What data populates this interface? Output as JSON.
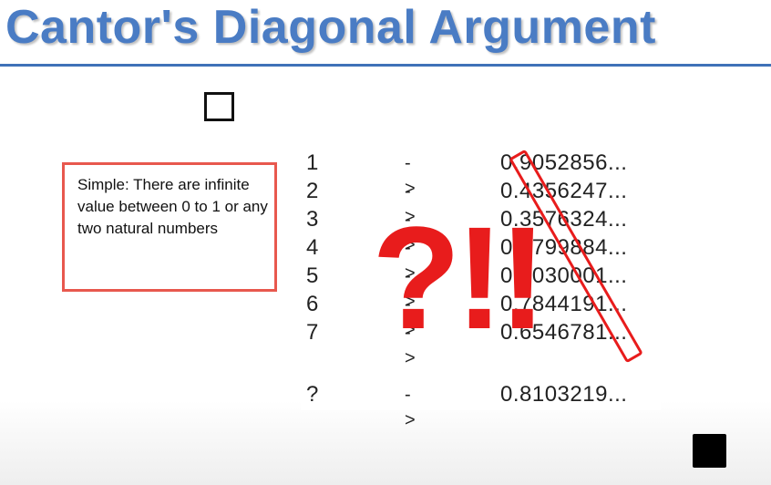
{
  "slide": {
    "title": "Cantor's Diagonal Argument",
    "callout_text": "Simple: There are infinite value between 0 to 1 or any two natural numbers",
    "overlay_text": "?!!"
  },
  "table": {
    "rows": [
      {
        "index": "1",
        "arrow": "->",
        "value": "0.9052856..."
      },
      {
        "index": "2",
        "arrow": "->",
        "value": "0.4356247..."
      },
      {
        "index": "3",
        "arrow": "->",
        "value": "0.3576324..."
      },
      {
        "index": "4",
        "arrow": "->",
        "value": "0.9799884..."
      },
      {
        "index": "5",
        "arrow": "->",
        "value": "0.0030001..."
      },
      {
        "index": "6",
        "arrow": "->",
        "value": "0.7844191..."
      },
      {
        "index": "7",
        "arrow": "->",
        "value": "0.6546781..."
      },
      {
        "index": "?",
        "arrow": "->",
        "value": "0.8103219..."
      }
    ]
  },
  "colors": {
    "title": "#4a7cc4",
    "rule": "#3f72b8",
    "callout_border": "#e8584e",
    "overlay_red": "#e81c1c"
  },
  "icons": {
    "top_checkbox": "checkbox-icon",
    "bottom_button": "stop-icon"
  }
}
